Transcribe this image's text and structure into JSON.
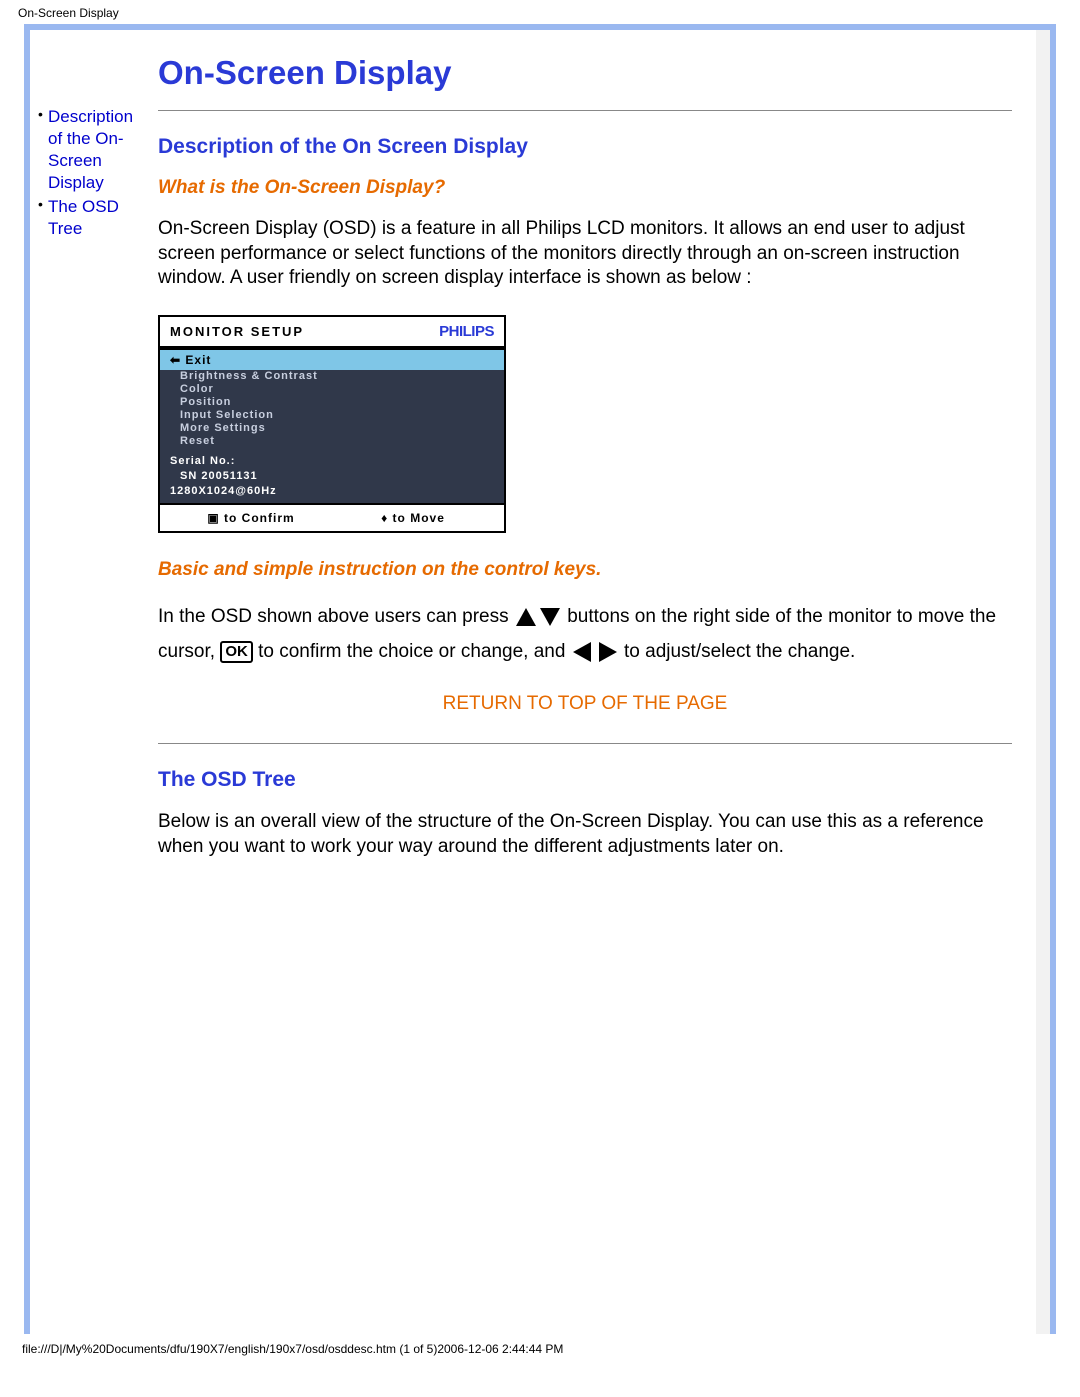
{
  "page_header": "On-Screen Display",
  "sidebar": {
    "items": [
      {
        "label": "Description of the On-Screen Display"
      },
      {
        "label": "The OSD Tree"
      }
    ]
  },
  "main": {
    "h1": "On-Screen Display",
    "section1": {
      "h2": "Description of the On Screen Display",
      "h3": "What is the On-Screen Display?",
      "p1": "On-Screen Display (OSD) is a feature in all Philips LCD monitors. It allows an end user to adjust screen performance or select functions of the monitors directly through an on-screen instruction window. A user friendly on screen display interface is shown as below :",
      "h3b": "Basic and simple instruction on the control keys.",
      "instr_a": "In the OSD shown above users can press ",
      "instr_b": " buttons on the right side of the monitor to move the cursor,",
      "instr_c": " to confirm the choice or change, and ",
      "instr_d": " to adjust/select the change."
    },
    "osd": {
      "header_title": "MONITOR SETUP",
      "brand": "PHILIPS",
      "exit": "⬅ Exit",
      "items": [
        "Brightness & Contrast",
        "Color",
        "Position",
        "Input Selection",
        "More Settings",
        "Reset"
      ],
      "serial_label": "Serial No.:",
      "serial_value": "SN 20051131",
      "resolution": "1280X1024@60Hz",
      "confirm": "▣ to Confirm",
      "move": "♦ to Move"
    },
    "return_link": "RETURN TO TOP OF THE PAGE",
    "section2": {
      "h2": "The OSD Tree",
      "p1": "Below is an overall view of the structure of the On-Screen Display. You can use this as a reference when you want to work your way around the different adjustments later on."
    }
  },
  "footer": "file:///D|/My%20Documents/dfu/190X7/english/190x7/osd/osddesc.htm (1 of 5)2006-12-06 2:44:44 PM"
}
